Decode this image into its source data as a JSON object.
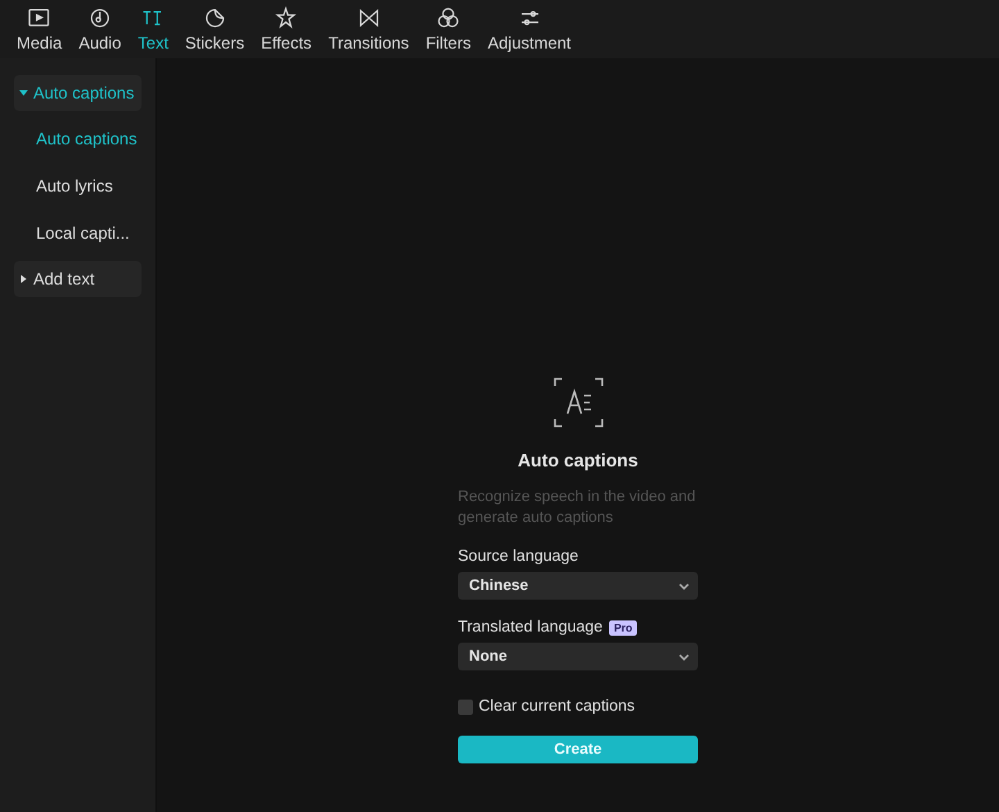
{
  "tabs": [
    {
      "label": "Media",
      "selected": false
    },
    {
      "label": "Audio",
      "selected": false
    },
    {
      "label": "Text",
      "selected": true
    },
    {
      "label": "Stickers",
      "selected": false
    },
    {
      "label": "Effects",
      "selected": false
    },
    {
      "label": "Transitions",
      "selected": false
    },
    {
      "label": "Filters",
      "selected": false
    },
    {
      "label": "Adjustment",
      "selected": false
    }
  ],
  "sidebar": {
    "items": [
      {
        "label": "Auto captions",
        "expanded": true,
        "selected": true,
        "children": [
          {
            "label": "Auto captions",
            "selected": true
          },
          {
            "label": "Auto lyrics",
            "selected": false
          },
          {
            "label": "Local capti...",
            "selected": false
          }
        ]
      },
      {
        "label": "Add text",
        "expanded": false,
        "selected": false
      }
    ]
  },
  "panel": {
    "title": "Auto captions",
    "description": "Recognize speech in the video and generate auto captions",
    "source_language": {
      "label": "Source language",
      "value": "Chinese"
    },
    "translated_language": {
      "label": "Translated language",
      "badge": "Pro",
      "value": "None"
    },
    "clear_captions": {
      "label": "Clear current captions",
      "checked": false
    },
    "create_button": "Create"
  }
}
